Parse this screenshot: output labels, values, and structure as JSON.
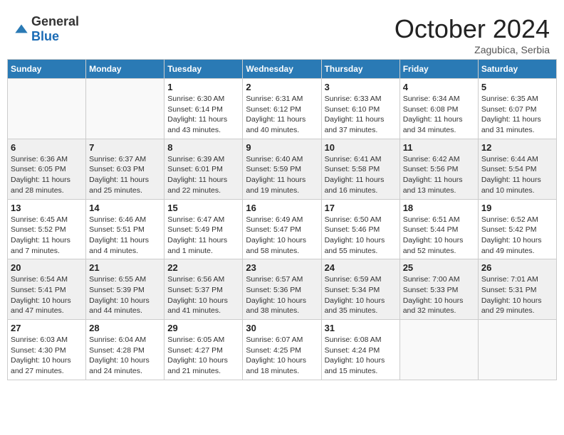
{
  "header": {
    "logo_general": "General",
    "logo_blue": "Blue",
    "month_title": "October 2024",
    "subtitle": "Zagubica, Serbia"
  },
  "days_of_week": [
    "Sunday",
    "Monday",
    "Tuesday",
    "Wednesday",
    "Thursday",
    "Friday",
    "Saturday"
  ],
  "weeks": [
    [
      {
        "day": "",
        "info": ""
      },
      {
        "day": "",
        "info": ""
      },
      {
        "day": "1",
        "info": "Sunrise: 6:30 AM\nSunset: 6:14 PM\nDaylight: 11 hours and 43 minutes."
      },
      {
        "day": "2",
        "info": "Sunrise: 6:31 AM\nSunset: 6:12 PM\nDaylight: 11 hours and 40 minutes."
      },
      {
        "day": "3",
        "info": "Sunrise: 6:33 AM\nSunset: 6:10 PM\nDaylight: 11 hours and 37 minutes."
      },
      {
        "day": "4",
        "info": "Sunrise: 6:34 AM\nSunset: 6:08 PM\nDaylight: 11 hours and 34 minutes."
      },
      {
        "day": "5",
        "info": "Sunrise: 6:35 AM\nSunset: 6:07 PM\nDaylight: 11 hours and 31 minutes."
      }
    ],
    [
      {
        "day": "6",
        "info": "Sunrise: 6:36 AM\nSunset: 6:05 PM\nDaylight: 11 hours and 28 minutes."
      },
      {
        "day": "7",
        "info": "Sunrise: 6:37 AM\nSunset: 6:03 PM\nDaylight: 11 hours and 25 minutes."
      },
      {
        "day": "8",
        "info": "Sunrise: 6:39 AM\nSunset: 6:01 PM\nDaylight: 11 hours and 22 minutes."
      },
      {
        "day": "9",
        "info": "Sunrise: 6:40 AM\nSunset: 5:59 PM\nDaylight: 11 hours and 19 minutes."
      },
      {
        "day": "10",
        "info": "Sunrise: 6:41 AM\nSunset: 5:58 PM\nDaylight: 11 hours and 16 minutes."
      },
      {
        "day": "11",
        "info": "Sunrise: 6:42 AM\nSunset: 5:56 PM\nDaylight: 11 hours and 13 minutes."
      },
      {
        "day": "12",
        "info": "Sunrise: 6:44 AM\nSunset: 5:54 PM\nDaylight: 11 hours and 10 minutes."
      }
    ],
    [
      {
        "day": "13",
        "info": "Sunrise: 6:45 AM\nSunset: 5:52 PM\nDaylight: 11 hours and 7 minutes."
      },
      {
        "day": "14",
        "info": "Sunrise: 6:46 AM\nSunset: 5:51 PM\nDaylight: 11 hours and 4 minutes."
      },
      {
        "day": "15",
        "info": "Sunrise: 6:47 AM\nSunset: 5:49 PM\nDaylight: 11 hours and 1 minute."
      },
      {
        "day": "16",
        "info": "Sunrise: 6:49 AM\nSunset: 5:47 PM\nDaylight: 10 hours and 58 minutes."
      },
      {
        "day": "17",
        "info": "Sunrise: 6:50 AM\nSunset: 5:46 PM\nDaylight: 10 hours and 55 minutes."
      },
      {
        "day": "18",
        "info": "Sunrise: 6:51 AM\nSunset: 5:44 PM\nDaylight: 10 hours and 52 minutes."
      },
      {
        "day": "19",
        "info": "Sunrise: 6:52 AM\nSunset: 5:42 PM\nDaylight: 10 hours and 49 minutes."
      }
    ],
    [
      {
        "day": "20",
        "info": "Sunrise: 6:54 AM\nSunset: 5:41 PM\nDaylight: 10 hours and 47 minutes."
      },
      {
        "day": "21",
        "info": "Sunrise: 6:55 AM\nSunset: 5:39 PM\nDaylight: 10 hours and 44 minutes."
      },
      {
        "day": "22",
        "info": "Sunrise: 6:56 AM\nSunset: 5:37 PM\nDaylight: 10 hours and 41 minutes."
      },
      {
        "day": "23",
        "info": "Sunrise: 6:57 AM\nSunset: 5:36 PM\nDaylight: 10 hours and 38 minutes."
      },
      {
        "day": "24",
        "info": "Sunrise: 6:59 AM\nSunset: 5:34 PM\nDaylight: 10 hours and 35 minutes."
      },
      {
        "day": "25",
        "info": "Sunrise: 7:00 AM\nSunset: 5:33 PM\nDaylight: 10 hours and 32 minutes."
      },
      {
        "day": "26",
        "info": "Sunrise: 7:01 AM\nSunset: 5:31 PM\nDaylight: 10 hours and 29 minutes."
      }
    ],
    [
      {
        "day": "27",
        "info": "Sunrise: 6:03 AM\nSunset: 4:30 PM\nDaylight: 10 hours and 27 minutes."
      },
      {
        "day": "28",
        "info": "Sunrise: 6:04 AM\nSunset: 4:28 PM\nDaylight: 10 hours and 24 minutes."
      },
      {
        "day": "29",
        "info": "Sunrise: 6:05 AM\nSunset: 4:27 PM\nDaylight: 10 hours and 21 minutes."
      },
      {
        "day": "30",
        "info": "Sunrise: 6:07 AM\nSunset: 4:25 PM\nDaylight: 10 hours and 18 minutes."
      },
      {
        "day": "31",
        "info": "Sunrise: 6:08 AM\nSunset: 4:24 PM\nDaylight: 10 hours and 15 minutes."
      },
      {
        "day": "",
        "info": ""
      },
      {
        "day": "",
        "info": ""
      }
    ]
  ]
}
